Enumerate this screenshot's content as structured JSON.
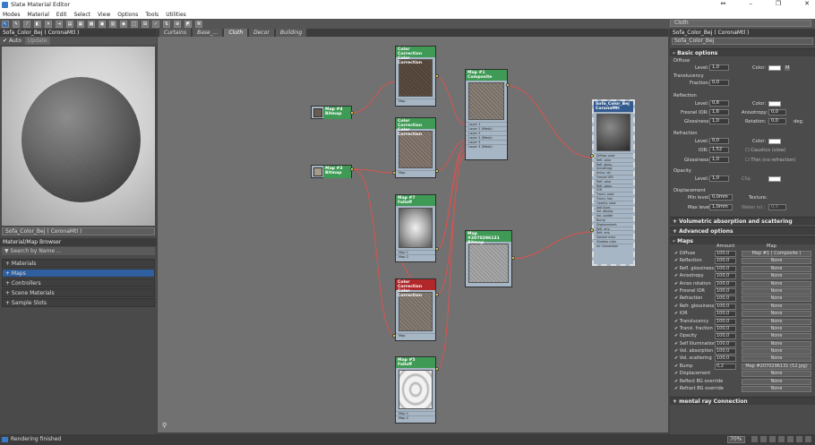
{
  "window": {
    "title": "Slate Material Editor",
    "controls": [
      "↔",
      "–",
      "❐",
      "✕"
    ]
  },
  "menu": [
    "Modes",
    "Material",
    "Edit",
    "Select",
    "View",
    "Options",
    "Tools",
    "Utilities"
  ],
  "toolbar": {
    "view_dropdown": "Cloth"
  },
  "left_panel": {
    "preview_title": "Sofa_Color_Bej  ( CoronaMtl )",
    "auto_label": "Auto",
    "update_label": "Update",
    "material_name": "Sofa_Color_Bej  ( CoronaMtl )",
    "browser_title": "Material/Map Browser",
    "search_placeholder": "Search by Name ...",
    "browser_items": [
      "+ Materials",
      "+ Maps",
      "+ Controllers",
      "+ Scene Materials",
      "+ Sample Slots"
    ]
  },
  "tabs": [
    "Curtains",
    "Base_...",
    "Cloth",
    "Decor",
    "Building"
  ],
  "nodes": {
    "map4": {
      "title": "Map #4",
      "subtitle": "Bitmap"
    },
    "map3": {
      "title": "Map #3",
      "subtitle": "Bitmap"
    },
    "cc1": {
      "title": "Color Correction",
      "subtitle": "Color Correction",
      "slot": "Map"
    },
    "cc2": {
      "title": "Color Correction",
      "subtitle": "Color Correction",
      "slot": "Map"
    },
    "composite": {
      "title": "Map #1",
      "subtitle": "Composite",
      "slots": [
        "Layer 1",
        "Layer 1 (Mask)",
        "Layer 2",
        "Layer 2 (Mask)",
        "Layer 3",
        "Layer 3 (Mask)"
      ]
    },
    "falloff7": {
      "title": "Map #7",
      "subtitle": "Falloff",
      "slots": [
        "Map 1",
        "Map 2"
      ]
    },
    "bitmap_big": {
      "title": "Map #2070296131",
      "subtitle": "Bitmap"
    },
    "cc_red": {
      "title": "Color Correction",
      "subtitle": "Color Correction",
      "slot": "Map"
    },
    "falloff5": {
      "title": "Map #5",
      "subtitle": "Falloff",
      "slots": [
        "Map 1",
        "Map 2"
      ]
    },
    "material": {
      "title": "Sofa_Color_Bej",
      "subtitle": "CoronaMtl",
      "slots": [
        "Diffuse color",
        "Refl. color",
        "Refl. gloss.",
        "Anisotropy",
        "Aniso. rot.",
        "Fresnel IOR",
        "Refr. color",
        "Refr. gloss.",
        "IOR",
        "Transl. color",
        "Transl. frac.",
        "Opacity color",
        "Self illum.",
        "Vol. absorp.",
        "Vol. scatter",
        "Bump",
        "Displacement",
        "Refl. env.",
        "Refr. env.",
        "Volume med.",
        "Shadow color",
        "mr Connection"
      ]
    }
  },
  "right_panel": {
    "title": "Sofa_Color_Bej  ( CoronaMtl )",
    "name_field": "Sofa_Color_Bej",
    "basic": {
      "header": "Basic options",
      "diffuse": {
        "label": "Diffuse",
        "level_label": "Level:",
        "level": "1,0",
        "color_label": "Color:",
        "color_tag": "M"
      },
      "translucency": {
        "label": "Translucency",
        "fraction_label": "Fraction:",
        "fraction": "0,0"
      },
      "reflection": {
        "label": "Reflection",
        "level_label": "Level:",
        "level": "0,8",
        "color_label": "Color:",
        "fresnel_label": "Fresnel IOR:",
        "fresnel": "1,6",
        "aniso_label": "Anisotropy:",
        "aniso": "0,0",
        "gloss_label": "Glossiness:",
        "gloss": "1,0",
        "rot_label": "Rotation:",
        "rot": "0,0",
        "deg": "deg."
      },
      "refraction": {
        "label": "Refraction",
        "level_label": "Level:",
        "level": "0,0",
        "color_label": "Color:",
        "ior_label": "IOR:",
        "ior": "1,52",
        "caustics": "Caustics (slow)",
        "gloss_label": "Glossiness:",
        "gloss": "1,0",
        "thin": "Thin (no refraction)"
      },
      "opacity": {
        "label": "Opacity",
        "level_label": "Level:",
        "level": "1,0",
        "color_label": "Clip"
      },
      "displacement": {
        "label": "Displacement",
        "min_label": "Min level:",
        "min": "0,0mm",
        "texture_label": "Texture:",
        "max_label": "Max level:",
        "max": "1,0mm",
        "water_label": "Water lvl.:",
        "water": "0,5"
      }
    },
    "sections": [
      "Volumetric absorption and scattering",
      "Advanced options"
    ],
    "maps_header": "Maps",
    "maps_cols": {
      "amount": "Amount",
      "map": "Map"
    },
    "maps": [
      {
        "name": "Diffuse",
        "amount": "100,0",
        "map": "Map #1  ( Composite )"
      },
      {
        "name": "Reflection",
        "amount": "100,0",
        "map": "None"
      },
      {
        "name": "Refl. glossiness",
        "amount": "100,0",
        "map": "None"
      },
      {
        "name": "Anisotropy",
        "amount": "100,0",
        "map": "None"
      },
      {
        "name": "Aniso rotation",
        "amount": "100,0",
        "map": "None"
      },
      {
        "name": "Fresnel IOR",
        "amount": "100,0",
        "map": "None"
      },
      {
        "name": "Refraction",
        "amount": "100,0",
        "map": "None"
      },
      {
        "name": "Refr. glossiness",
        "amount": "100,0",
        "map": "None"
      },
      {
        "name": "IOR",
        "amount": "100,0",
        "map": "None"
      },
      {
        "name": "Translucency",
        "amount": "100,0",
        "map": "None"
      },
      {
        "name": "Transl. fraction",
        "amount": "100,0",
        "map": "None"
      },
      {
        "name": "Opacity",
        "amount": "100,0",
        "map": "None"
      },
      {
        "name": "Self Illumination",
        "amount": "100,0",
        "map": "None"
      },
      {
        "name": "Vol. absorption",
        "amount": "100,0",
        "map": "None"
      },
      {
        "name": "Vol. scattering",
        "amount": "100,0",
        "map": "None"
      },
      {
        "name": "Bump",
        "amount": "0,2",
        "map": "Map #2070296131 (52.jpg)"
      },
      {
        "name": "Displacement",
        "amount": "",
        "map": "None"
      },
      {
        "name": "Reflect BG override",
        "amount": "",
        "map": "None"
      },
      {
        "name": "Refract BG override",
        "amount": "",
        "map": "None"
      }
    ],
    "mr_section": "mental ray Connection"
  },
  "status": {
    "text": "Rendering finished",
    "zoom": "70%"
  }
}
